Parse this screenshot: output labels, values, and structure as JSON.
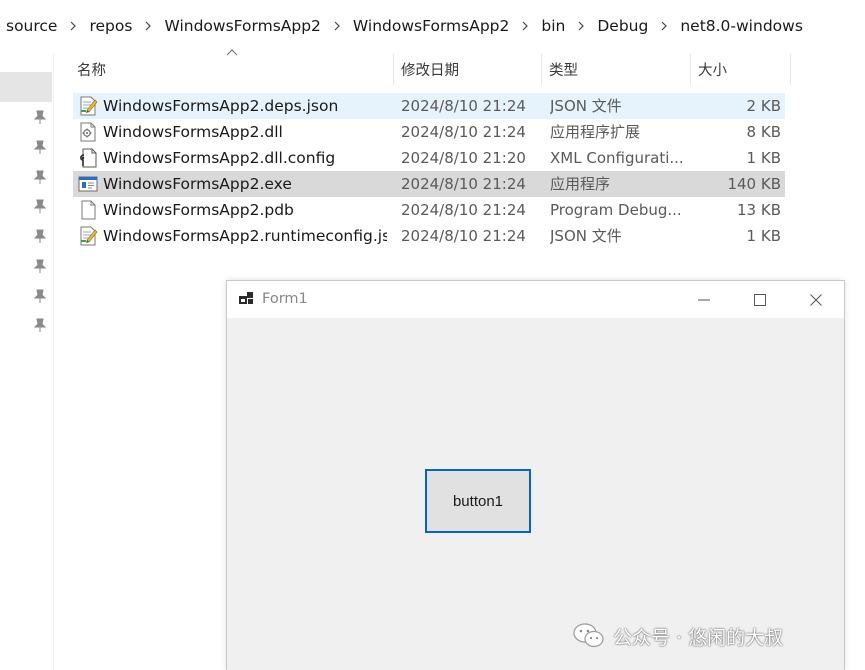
{
  "breadcrumb": [
    "source",
    "repos",
    "WindowsFormsApp2",
    "WindowsFormsApp2",
    "bin",
    "Debug",
    "net8.0-windows"
  ],
  "columns": {
    "name": "名称",
    "date": "修改日期",
    "type": "类型",
    "size": "大小"
  },
  "files": [
    {
      "name": "WindowsFormsApp2.deps.json",
      "date": "2024/8/10 21:24",
      "type": "JSON 文件",
      "size": "2 KB",
      "icon": "json-file-icon"
    },
    {
      "name": "WindowsFormsApp2.dll",
      "date": "2024/8/10 21:24",
      "type": "应用程序扩展",
      "size": "8 KB",
      "icon": "dll-file-icon"
    },
    {
      "name": "WindowsFormsApp2.dll.config",
      "date": "2024/8/10 21:20",
      "type": "XML Configurati...",
      "size": "1 KB",
      "icon": "config-file-icon"
    },
    {
      "name": "WindowsFormsApp2.exe",
      "date": "2024/8/10 21:24",
      "type": "应用程序",
      "size": "140 KB",
      "icon": "exe-file-icon"
    },
    {
      "name": "WindowsFormsApp2.pdb",
      "date": "2024/8/10 21:24",
      "type": "Program Debug...",
      "size": "13 KB",
      "icon": "blank-file-icon"
    },
    {
      "name": "WindowsFormsApp2.runtimeconfig.js...",
      "date": "2024/8/10 21:24",
      "type": "JSON 文件",
      "size": "1 KB",
      "icon": "json-file-icon"
    }
  ],
  "form": {
    "title": "Form1",
    "button_label": "button1"
  },
  "watermark": {
    "text": "公众号 · 悠闲的大叔"
  },
  "colors": {
    "accent": "#0a62c4",
    "row_hover": "#e6f2fc",
    "row_selected": "#d9d9d9",
    "form_bg": "#f0f0f0"
  }
}
